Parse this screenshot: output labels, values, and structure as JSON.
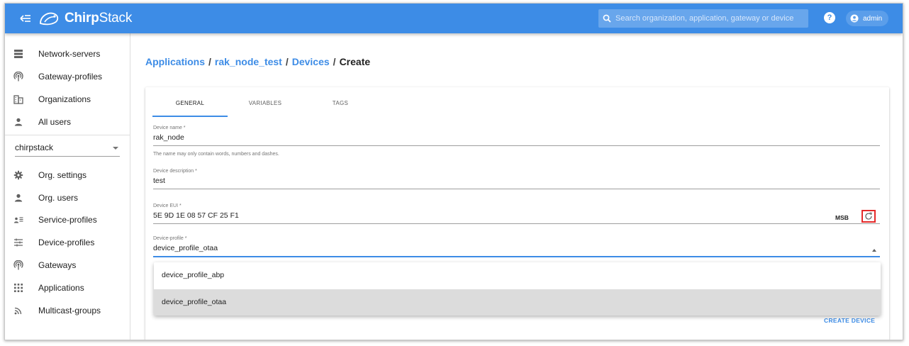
{
  "header": {
    "logo_bold": "Chirp",
    "logo_regular": "Stack",
    "search_placeholder": "Search organization, application, gateway or device",
    "help_label": "?",
    "user_name": "admin"
  },
  "sidebar": {
    "admin_items": [
      {
        "label": "Network-servers",
        "icon": "server-icon"
      },
      {
        "label": "Gateway-profiles",
        "icon": "radio-tower-icon"
      },
      {
        "label": "Organizations",
        "icon": "domain-icon"
      },
      {
        "label": "All users",
        "icon": "user-icon"
      }
    ],
    "org_selector": "chirpstack",
    "org_items": [
      {
        "label": "Org. settings",
        "icon": "gear-icon"
      },
      {
        "label": "Org. users",
        "icon": "user-icon"
      },
      {
        "label": "Service-profiles",
        "icon": "user-list-icon"
      },
      {
        "label": "Device-profiles",
        "icon": "sliders-icon"
      },
      {
        "label": "Gateways",
        "icon": "radio-tower-icon"
      },
      {
        "label": "Applications",
        "icon": "apps-grid-icon"
      },
      {
        "label": "Multicast-groups",
        "icon": "rss-icon"
      }
    ]
  },
  "breadcrumb": {
    "items": [
      "Applications",
      "rak_node_test",
      "Devices"
    ],
    "separator": "/",
    "current": "Create"
  },
  "tabs": [
    "GENERAL",
    "VARIABLES",
    "TAGS"
  ],
  "form": {
    "device_name": {
      "label": "Device name *",
      "value": "rak_node",
      "helper": "The name may only contain words, numbers and dashes."
    },
    "device_description": {
      "label": "Device description *",
      "value": "test"
    },
    "device_eui": {
      "label": "Device EUI *",
      "value": "5E 9D 1E 08 57 CF 25 F1",
      "byte_order": "MSB"
    },
    "device_profile": {
      "label": "Device-profile *",
      "value": "device_profile_otaa"
    }
  },
  "dropdown": {
    "options": [
      "device_profile_abp",
      "device_profile_otaa"
    ],
    "selected": "device_profile_otaa"
  },
  "actions": {
    "create_label": "CREATE DEVICE"
  },
  "colors": {
    "primary": "#3d8ce6",
    "highlight": "#e52a2a"
  }
}
